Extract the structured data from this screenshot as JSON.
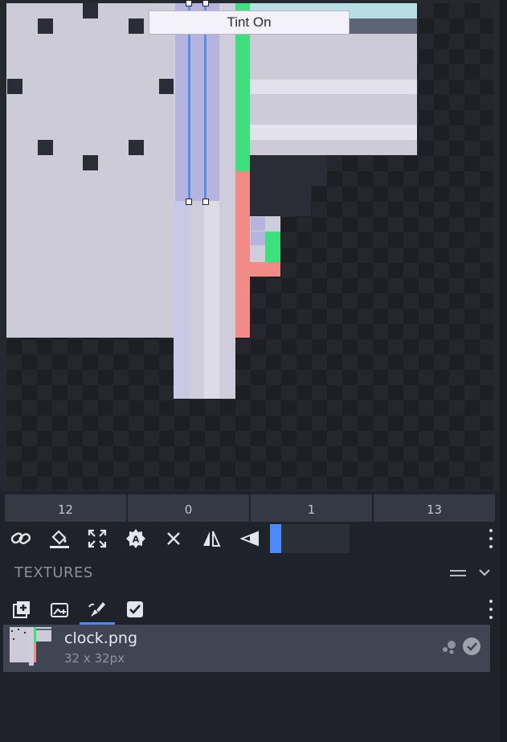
{
  "tooltip": {
    "text": "Tint On"
  },
  "coordinates": [
    "12",
    "0",
    "1",
    "13"
  ],
  "toolbar": {
    "tools": [
      "link-icon",
      "paint-bucket-icon",
      "fit-frame-icon",
      "auto-badge-icon",
      "close-icon",
      "mirror-icon",
      "perspective-icon"
    ],
    "slider_value_percent": 14
  },
  "textures_panel": {
    "title": "TEXTURES",
    "tabs": [
      "add-texture-icon",
      "add-image-icon",
      "paint-tool-icon",
      "select-all-icon"
    ],
    "active_tab_index": 2,
    "items": [
      {
        "name": "clock.png",
        "size": "32 x 32px"
      }
    ]
  },
  "colors": {
    "accent": "#4a8cf7",
    "texture_light": "#cdcbd8",
    "green": "#3ee07e",
    "salmon": "#f28a86",
    "panel": "#404553"
  }
}
